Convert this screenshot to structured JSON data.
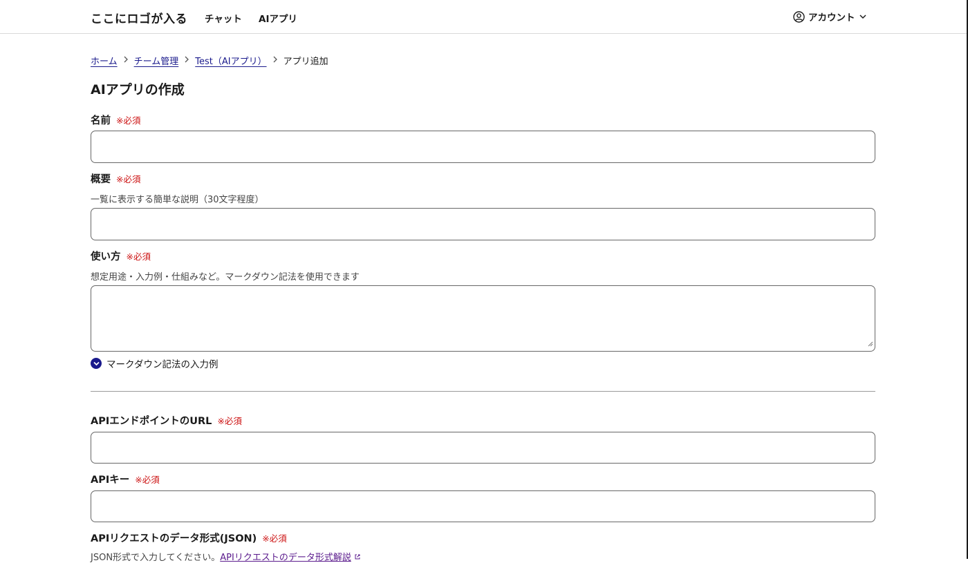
{
  "header": {
    "logo": "ここにロゴが入る",
    "nav": [
      {
        "label": "チャット"
      },
      {
        "label": "AIアプリ"
      }
    ],
    "account_label": "アカウント"
  },
  "breadcrumb": {
    "items": [
      {
        "label": "ホーム"
      },
      {
        "label": "チーム管理"
      },
      {
        "label": "Test（AIアプリ）"
      }
    ],
    "current": "アプリ追加"
  },
  "page_title": "AIアプリの作成",
  "required_mark": "※必須",
  "fields": {
    "name": {
      "label": "名前",
      "value": ""
    },
    "summary": {
      "label": "概要",
      "help": "一覧に表示する簡単な説明（30文字程度）",
      "value": ""
    },
    "usage": {
      "label": "使い方",
      "help": "想定用途・入力例・仕組みなど。マークダウン記法を使用できます",
      "value": ""
    },
    "endpoint": {
      "label": "APIエンドポイントのURL",
      "value": ""
    },
    "apikey": {
      "label": "APIキー",
      "value": ""
    },
    "json": {
      "label": "APIリクエストのデータ形式(JSON)",
      "help": "JSON形式で入力してください。",
      "help_link": "APIリクエストのデータ形式解説"
    }
  },
  "markdown_toggle": "マークダウン記法の入力例",
  "colors": {
    "link": "#1a1a8c",
    "required": "#cc1111",
    "visited_link": "#5a1a8c"
  }
}
